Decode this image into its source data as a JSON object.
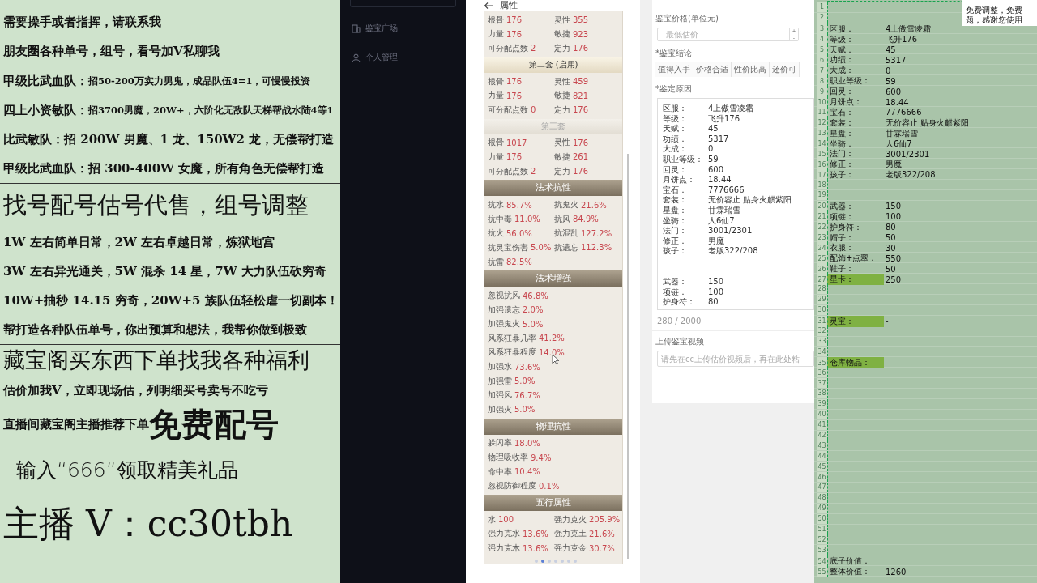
{
  "promo": {
    "groups": [
      [
        {
          "parts": [
            {
              "text": "需要操手或者指挥，请联系我",
              "kind": "normal"
            }
          ]
        },
        {
          "parts": [
            {
              "text": "朋友圈各种单号，组号，看号加V私聊我",
              "kind": "normal"
            }
          ]
        }
      ],
      [
        {
          "parts": [
            {
              "text": "甲级比武血队：",
              "kind": "normal"
            },
            {
              "text": "招50-200万实力男鬼，成品队伍4=1，可慢慢投资",
              "kind": "small"
            }
          ]
        },
        {
          "parts": [
            {
              "text": "四上小资敏队：",
              "kind": "normal"
            },
            {
              "text": "招3700男魔，20W+，六阶化无敌队天梯帮战水陆4等1",
              "kind": "small"
            }
          ]
        },
        {
          "parts": [
            {
              "text": "比武敏队：招 200W 男魔、1 龙、150W2 龙，无偿帮打造",
              "kind": "normal"
            }
          ]
        },
        {
          "parts": [
            {
              "text": "甲级比武血队：招 300-400W 女魔，所有角色无偿帮打造",
              "kind": "normal"
            }
          ]
        }
      ],
      [
        {
          "parts": [
            {
              "text": "找号配号估号代售，组号调整",
              "kind": "heading"
            }
          ]
        },
        {
          "parts": [
            {
              "text": "1W 左右简单日常，2W 左右卓越日常，炼狱地宫",
              "kind": "normal"
            }
          ]
        },
        {
          "parts": [
            {
              "text": "3W 左右异光通关，5W 混杀 14 星，7W 大力队伍砍穷奇",
              "kind": "normal"
            }
          ]
        },
        {
          "parts": [
            {
              "text": "10W+抽秒 14.15 穷奇，20W+5 族队伍轻松虐一切副本！",
              "kind": "normal"
            }
          ]
        },
        {
          "parts": [
            {
              "text": "帮打造各种队伍单号，你出预算和想法，我帮你做到极致",
              "kind": "normal"
            }
          ]
        }
      ],
      [
        {
          "parts": [
            {
              "text": "藏宝阁买东西下单找我各种福利",
              "kind": "title"
            }
          ]
        },
        {
          "parts": [
            {
              "text": "估价加我V，立即现场估，列明细买号卖号不吃亏",
              "kind": "normal"
            }
          ]
        },
        {
          "parts": [
            {
              "text": "直播间藏宝阁主播推荐下单",
              "kind": "normal"
            },
            {
              "text": "免费配号",
              "kind": "emphasis"
            }
          ]
        },
        {
          "parts": [
            {
              "text": "输入“666”领取精美礼品",
              "kind": "light"
            }
          ]
        },
        {
          "parts": [
            {
              "text": "主播 V：cc30tbh",
              "kind": "huge"
            }
          ]
        }
      ]
    ]
  },
  "sidebar": {
    "items": [
      {
        "label": "鉴宝广场",
        "selected": false
      },
      {
        "label": "个人管理",
        "selected": false
      }
    ]
  },
  "attributes": {
    "title": "属性",
    "sections": [
      {
        "kind": "grid",
        "items": [
          {
            "label": "根骨",
            "value": "176"
          },
          {
            "label": "灵性",
            "value": "355"
          },
          {
            "label": "力量",
            "value": "176"
          },
          {
            "label": "敏捷",
            "value": "923"
          },
          {
            "label": "可分配点数",
            "value": "2"
          },
          {
            "label": "定力",
            "value": "176"
          }
        ]
      },
      {
        "kind": "set_header",
        "text": "第二套 (启用)",
        "active": true
      },
      {
        "kind": "grid",
        "items": [
          {
            "label": "根骨",
            "value": "176"
          },
          {
            "label": "灵性",
            "value": "459"
          },
          {
            "label": "力量",
            "value": "176"
          },
          {
            "label": "敏捷",
            "value": "821"
          },
          {
            "label": "可分配点数",
            "value": "0"
          },
          {
            "label": "定力",
            "value": "176"
          }
        ]
      },
      {
        "kind": "set_header",
        "text": "第三套",
        "active": false
      },
      {
        "kind": "grid",
        "items": [
          {
            "label": "根骨",
            "value": "1017"
          },
          {
            "label": "灵性",
            "value": "176"
          },
          {
            "label": "力量",
            "value": "176"
          },
          {
            "label": "敏捷",
            "value": "261"
          },
          {
            "label": "可分配点数",
            "value": "2"
          },
          {
            "label": "定力",
            "value": "176"
          }
        ]
      },
      {
        "kind": "category_header",
        "text": "法术抗性"
      },
      {
        "kind": "grid",
        "items": [
          {
            "label": "抗水",
            "value": "85.7%"
          },
          {
            "label": "抗鬼火",
            "value": "21.6%"
          },
          {
            "label": "抗中毒",
            "value": "11.0%"
          },
          {
            "label": "抗风",
            "value": "84.9%"
          },
          {
            "label": "抗火",
            "value": "56.0%"
          },
          {
            "label": "抗混乱",
            "value": "127.2%"
          },
          {
            "label": "抗灵宝伤害",
            "value": "5.0%"
          },
          {
            "label": "抗遗忘",
            "value": "112.3%"
          },
          {
            "label": "抗雷",
            "value": "82.5%"
          }
        ]
      },
      {
        "kind": "category_header",
        "text": "法术增强"
      },
      {
        "kind": "list",
        "items": [
          {
            "label": "忽视抗风",
            "value": "46.8%"
          },
          {
            "label": "加强遗忘",
            "value": "2.0%"
          },
          {
            "label": "加强鬼火",
            "value": "5.0%"
          },
          {
            "label": "风系狂暴几率",
            "value": "41.2%"
          },
          {
            "label": "风系狂暴程度",
            "value": "14.0%"
          },
          {
            "label": "加强水",
            "value": "73.6%"
          },
          {
            "label": "加强雷",
            "value": "5.0%"
          },
          {
            "label": "加强风",
            "value": "76.7%"
          },
          {
            "label": "加强火",
            "value": "5.0%"
          }
        ]
      },
      {
        "kind": "category_header",
        "text": "物理抗性"
      },
      {
        "kind": "list",
        "items": [
          {
            "label": "躲闪率",
            "value": "18.0%"
          },
          {
            "label": "物理吸收率",
            "value": "9.4%"
          },
          {
            "label": "命中率",
            "value": "10.4%"
          },
          {
            "label": "忽视防御程度",
            "value": "0.1%"
          }
        ]
      },
      {
        "kind": "category_header",
        "text": "五行属性"
      },
      {
        "kind": "grid",
        "items": [
          {
            "label": "水",
            "value": "100"
          },
          {
            "label": "强力克火",
            "value": "205.9%"
          },
          {
            "label": "强力克水",
            "value": "13.6%"
          },
          {
            "label": "强力克土",
            "value": "21.6%"
          },
          {
            "label": "强力克木",
            "value": "13.6%"
          },
          {
            "label": "强力克金",
            "value": "30.7%"
          }
        ]
      }
    ],
    "page_dots": [
      {
        "selected": false
      },
      {
        "selected": true
      },
      {
        "selected": false
      },
      {
        "selected": false
      },
      {
        "selected": false
      },
      {
        "selected": false
      },
      {
        "selected": false
      }
    ]
  },
  "form": {
    "price_label": "鉴宝价格(单位元)",
    "price_placeholder": "最低估价",
    "stepper": [
      "+",
      "-"
    ],
    "conclusion_label": "*鉴宝结论",
    "conclusions": [
      {
        "label": "值得入手",
        "selected": false
      },
      {
        "label": "价格合适",
        "selected": false
      },
      {
        "label": "性价比高",
        "selected": false
      },
      {
        "label": "还价可",
        "selected": false
      }
    ],
    "reason_label": "*鉴定原因",
    "reason_blocks": [
      [
        [
          "区服：",
          "4上傲雪凌霜"
        ],
        [
          "等级：",
          "飞升176"
        ],
        [
          "天赋：",
          "45"
        ],
        [
          "功绩：",
          "5317"
        ],
        [
          "大成：",
          "0"
        ],
        [
          "职业等级：",
          "59"
        ],
        [
          "回灵：",
          "600"
        ],
        [
          "月饼点：",
          "18.44"
        ],
        [
          "宝石：",
          "7776666"
        ],
        [
          "套装：",
          "无价容止 贴身火麒紫阳"
        ],
        [
          "星盘：",
          "甘霖瑞雪"
        ],
        [
          "坐骑：",
          "人6仙7"
        ],
        [
          "法门：",
          "3001/2301"
        ],
        [
          "修正：",
          "男魔"
        ],
        [
          "孩子：",
          "老版322/208"
        ]
      ],
      [
        [
          "武器：",
          "150"
        ],
        [
          "项链：",
          "100"
        ],
        [
          "护身符：",
          "80"
        ]
      ]
    ],
    "count": "280 / 2000",
    "video_label": "上传鉴宝视频",
    "video_placeholder": "请先在cc上传估价视频后，再在此处粘"
  },
  "sheet": {
    "rows": [
      {
        "number": "1"
      },
      {
        "number": "2"
      },
      {
        "number": "3",
        "label": "区服：",
        "value": "4上傲雪凌霜",
        "highlight": false
      },
      {
        "number": "4",
        "label": "等级：",
        "value": "飞升176",
        "highlight": false
      },
      {
        "number": "5",
        "label": "天赋：",
        "value": "45",
        "highlight": false
      },
      {
        "number": "6",
        "label": "功绩：",
        "value": "5317",
        "highlight": false
      },
      {
        "number": "7",
        "label": "大成：",
        "value": "0",
        "highlight": false
      },
      {
        "number": "8",
        "label": "职业等级：",
        "value": "59",
        "highlight": false
      },
      {
        "number": "9",
        "label": "回灵：",
        "value": "600",
        "highlight": false
      },
      {
        "number": "10",
        "label": "月饼点：",
        "value": "18.44",
        "highlight": false
      },
      {
        "number": "11",
        "label": "宝石：",
        "value": "7776666",
        "highlight": false
      },
      {
        "number": "12",
        "label": "套装：",
        "value": "无价容止 贴身火麒紫阳",
        "highlight": false
      },
      {
        "number": "13",
        "label": "星盘：",
        "value": "甘霖瑞雪",
        "highlight": false
      },
      {
        "number": "14",
        "label": "坐骑：",
        "value": "人6仙7",
        "highlight": false
      },
      {
        "number": "15",
        "label": "法门：",
        "value": "3001/2301",
        "highlight": false
      },
      {
        "number": "16",
        "label": "修正：",
        "value": "男魔",
        "highlight": false
      },
      {
        "number": "17",
        "label": "孩子：",
        "value": "老版322/208",
        "highlight": false
      },
      {
        "number": "18"
      },
      {
        "number": "19"
      },
      {
        "number": "20",
        "label": "武器：",
        "value": "150",
        "highlight": false
      },
      {
        "number": "21",
        "label": "项链：",
        "value": "100",
        "highlight": false
      },
      {
        "number": "22",
        "label": "护身符：",
        "value": "80",
        "highlight": false
      },
      {
        "number": "23",
        "label": "帽子：",
        "value": "50",
        "highlight": false
      },
      {
        "number": "24",
        "label": "衣服：",
        "value": "30",
        "highlight": false
      },
      {
        "number": "25",
        "label": "配饰+点翠：",
        "value": "550",
        "highlight": false
      },
      {
        "number": "26",
        "label": "鞋子：",
        "value": "50",
        "highlight": false
      },
      {
        "number": "27",
        "label": "星卡：",
        "value": "250",
        "highlight": true
      },
      {
        "number": "28"
      },
      {
        "number": "29"
      },
      {
        "number": "30"
      },
      {
        "number": "31",
        "label": "灵宝：",
        "value": "-",
        "highlight": true
      },
      {
        "number": "32"
      },
      {
        "number": "33"
      },
      {
        "number": "34"
      },
      {
        "number": "35",
        "label": "仓库物品：",
        "highlight": true
      },
      {
        "number": "36"
      },
      {
        "number": "37"
      },
      {
        "number": "38"
      },
      {
        "number": "39"
      },
      {
        "number": "40"
      },
      {
        "number": "41"
      },
      {
        "number": "42"
      },
      {
        "number": "43"
      },
      {
        "number": "44"
      },
      {
        "number": "45"
      },
      {
        "number": "46"
      },
      {
        "number": "47"
      },
      {
        "number": "48"
      },
      {
        "number": "49"
      },
      {
        "number": "50"
      },
      {
        "number": "51"
      },
      {
        "number": "52"
      },
      {
        "number": "53"
      },
      {
        "number": "54",
        "label": "底子价值：",
        "highlight": false
      },
      {
        "number": "55",
        "label": "整体价值：",
        "value": "1260",
        "highlight": false
      }
    ],
    "notice": [
      "免费调整，免费",
      "题，感谢您使用"
    ]
  }
}
